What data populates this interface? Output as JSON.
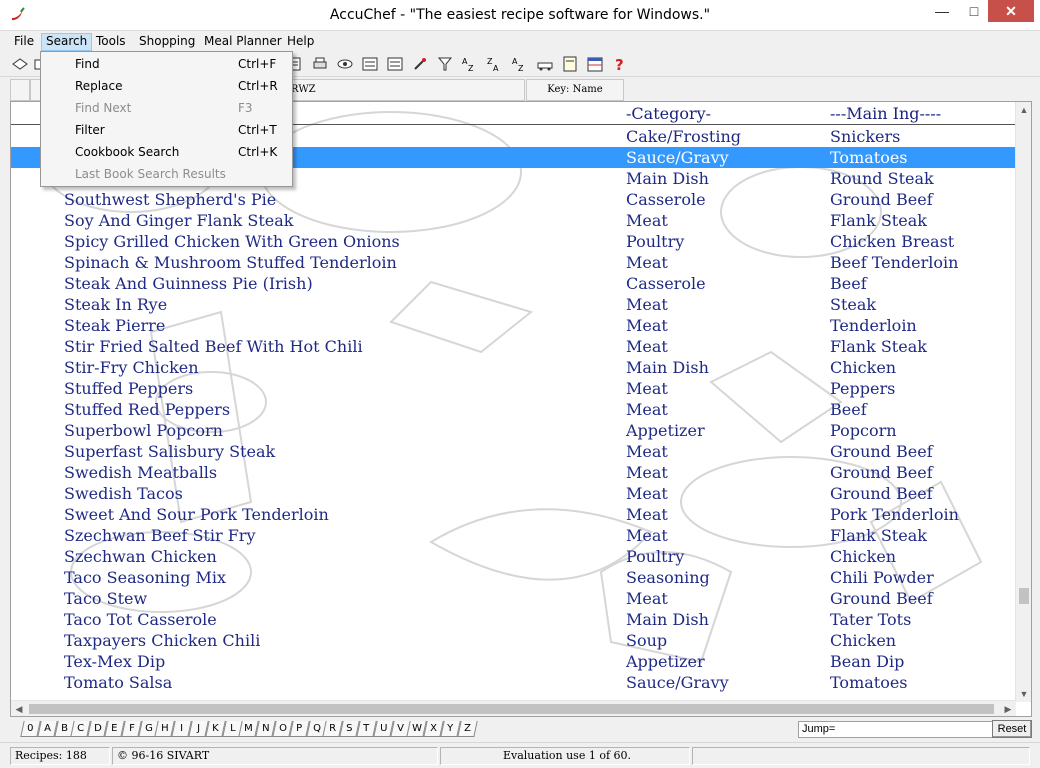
{
  "window": {
    "title": "AccuChef - \"The easiest recipe software for Windows.\""
  },
  "menubar": {
    "items": [
      "File",
      "Search",
      "Tools",
      "Shopping",
      "Meal Planner",
      "Help"
    ]
  },
  "toolbar": {
    "icons": [
      "open-book-icon",
      "copy-icon",
      "search-icon",
      "print-icon",
      "eye-icon",
      "list-icon",
      "list-icon",
      "pen-icon",
      "filter-icon",
      "sort-az-icon",
      "sort-za-icon",
      "sort-az-icon",
      "car-icon",
      "note-icon",
      "calendar-icon",
      "help-icon"
    ]
  },
  "columns": {
    "file": "Softpedia.RWZ",
    "key": "Key: Name"
  },
  "list": {
    "header": {
      "category": "-Category-",
      "ingredient": "---Main Ing----"
    },
    "rows": [
      {
        "name": "",
        "category": "Cake/Frosting",
        "ingredient": "Snickers"
      },
      {
        "name": "",
        "category": "Sauce/Gravy",
        "ingredient": "Tomatoes",
        "selected": true
      },
      {
        "name": "",
        "category": "Main Dish",
        "ingredient": "Round Steak"
      },
      {
        "name": "Southwest Shepherd's Pie",
        "category": "Casserole",
        "ingredient": "Ground Beef"
      },
      {
        "name": "Soy And Ginger Flank Steak",
        "category": "Meat",
        "ingredient": "Flank Steak"
      },
      {
        "name": "Spicy Grilled Chicken With Green Onions",
        "category": "Poultry",
        "ingredient": "Chicken Breast"
      },
      {
        "name": "Spinach & Mushroom Stuffed Tenderloin",
        "category": "Meat",
        "ingredient": "Beef Tenderloin"
      },
      {
        "name": "Steak And Guinness Pie (Irish)",
        "category": "Casserole",
        "ingredient": "Beef"
      },
      {
        "name": "Steak In Rye",
        "category": "Meat",
        "ingredient": "Steak"
      },
      {
        "name": "Steak Pierre",
        "category": "Meat",
        "ingredient": "Tenderloin"
      },
      {
        "name": "Stir Fried Salted Beef With Hot Chili",
        "category": "Meat",
        "ingredient": "Flank Steak"
      },
      {
        "name": "Stir-Fry Chicken",
        "category": "Main Dish",
        "ingredient": "Chicken"
      },
      {
        "name": "Stuffed Peppers",
        "category": "Meat",
        "ingredient": "Peppers"
      },
      {
        "name": "Stuffed Red Peppers",
        "category": "Meat",
        "ingredient": "Beef"
      },
      {
        "name": "Superbowl Popcorn",
        "category": "Appetizer",
        "ingredient": "Popcorn"
      },
      {
        "name": "Superfast Salisbury Steak",
        "category": "Meat",
        "ingredient": "Ground Beef"
      },
      {
        "name": "Swedish Meatballs",
        "category": "Meat",
        "ingredient": "Ground Beef"
      },
      {
        "name": "Swedish Tacos",
        "category": "Meat",
        "ingredient": "Ground Beef"
      },
      {
        "name": "Sweet And Sour Pork Tenderloin",
        "category": "Meat",
        "ingredient": "Pork Tenderloin"
      },
      {
        "name": "Szechwan Beef Stir Fry",
        "category": "Meat",
        "ingredient": "Flank Steak"
      },
      {
        "name": "Szechwan Chicken",
        "category": "Poultry",
        "ingredient": "Chicken"
      },
      {
        "name": "Taco Seasoning Mix",
        "category": "Seasoning",
        "ingredient": "Chili Powder"
      },
      {
        "name": "Taco Stew",
        "category": "Meat",
        "ingredient": "Ground Beef"
      },
      {
        "name": "Taco Tot Casserole",
        "category": "Main Dish",
        "ingredient": "Tater Tots"
      },
      {
        "name": "Taxpayers Chicken Chili",
        "category": "Soup",
        "ingredient": "Chicken"
      },
      {
        "name": "Tex-Mex Dip",
        "category": "Appetizer",
        "ingredient": "Bean Dip"
      },
      {
        "name": "Tomato Salsa",
        "category": "Sauce/Gravy",
        "ingredient": "Tomatoes"
      }
    ]
  },
  "search_menu": {
    "items": [
      {
        "label": "Find",
        "shortcut": "Ctrl+F",
        "enabled": true
      },
      {
        "label": "Replace",
        "shortcut": "Ctrl+R",
        "enabled": true
      },
      {
        "label": "Find Next",
        "shortcut": "F3",
        "enabled": false
      },
      {
        "label": "Filter",
        "shortcut": "Ctrl+T",
        "enabled": true
      },
      {
        "label": "Cookbook Search",
        "shortcut": "Ctrl+K",
        "enabled": true
      },
      {
        "label": "Last Book Search Results",
        "shortcut": "",
        "enabled": false
      }
    ]
  },
  "alphabet": [
    "0",
    "A",
    "B",
    "C",
    "D",
    "E",
    "F",
    "G",
    "H",
    "I",
    "J",
    "K",
    "L",
    "M",
    "N",
    "O",
    "P",
    "Q",
    "R",
    "S",
    "T",
    "U",
    "V",
    "W",
    "X",
    "Y",
    "Z"
  ],
  "jump": {
    "label": "Jump=",
    "reset_label": "Reset"
  },
  "status": {
    "recipes": "Recipes: 188",
    "copyright": "© 96-16 SIVART",
    "evaluation": "Evaluation use 1 of 60."
  },
  "colors": {
    "selection": "#3399ff",
    "list_text": "#1f2a85",
    "close_button": "#c7514a"
  }
}
